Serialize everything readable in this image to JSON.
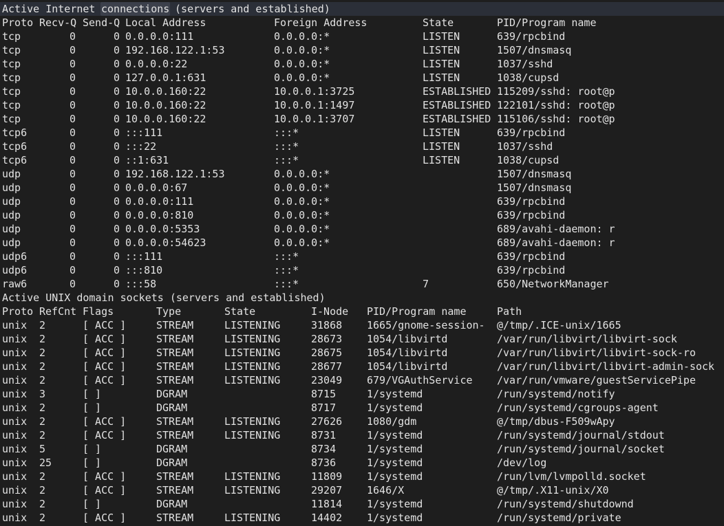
{
  "inet": {
    "title_prefix": "Active Internet ",
    "title_highlight": "connections",
    "title_suffix": " (servers and established)",
    "headers": [
      "Proto",
      "Recv-Q",
      "Send-Q",
      "Local Address",
      "Foreign Address",
      "State",
      "PID/Program name"
    ],
    "rows": [
      [
        "tcp",
        "0",
        "0",
        "0.0.0.0:111",
        "0.0.0.0:*",
        "LISTEN",
        "639/rpcbind"
      ],
      [
        "tcp",
        "0",
        "0",
        "192.168.122.1:53",
        "0.0.0.0:*",
        "LISTEN",
        "1507/dnsmasq"
      ],
      [
        "tcp",
        "0",
        "0",
        "0.0.0.0:22",
        "0.0.0.0:*",
        "LISTEN",
        "1037/sshd"
      ],
      [
        "tcp",
        "0",
        "0",
        "127.0.0.1:631",
        "0.0.0.0:*",
        "LISTEN",
        "1038/cupsd"
      ],
      [
        "tcp",
        "0",
        "0",
        "10.0.0.160:22",
        "10.0.0.1:3725",
        "ESTABLISHED",
        "115209/sshd: root@p"
      ],
      [
        "tcp",
        "0",
        "0",
        "10.0.0.160:22",
        "10.0.0.1:1497",
        "ESTABLISHED",
        "122101/sshd: root@p"
      ],
      [
        "tcp",
        "0",
        "0",
        "10.0.0.160:22",
        "10.0.0.1:3707",
        "ESTABLISHED",
        "115106/sshd: root@p"
      ],
      [
        "tcp6",
        "0",
        "0",
        ":::111",
        ":::*",
        "LISTEN",
        "639/rpcbind"
      ],
      [
        "tcp6",
        "0",
        "0",
        ":::22",
        ":::*",
        "LISTEN",
        "1037/sshd"
      ],
      [
        "tcp6",
        "0",
        "0",
        "::1:631",
        ":::*",
        "LISTEN",
        "1038/cupsd"
      ],
      [
        "udp",
        "0",
        "0",
        "192.168.122.1:53",
        "0.0.0.0:*",
        "",
        "1507/dnsmasq"
      ],
      [
        "udp",
        "0",
        "0",
        "0.0.0.0:67",
        "0.0.0.0:*",
        "",
        "1507/dnsmasq"
      ],
      [
        "udp",
        "0",
        "0",
        "0.0.0.0:111",
        "0.0.0.0:*",
        "",
        "639/rpcbind"
      ],
      [
        "udp",
        "0",
        "0",
        "0.0.0.0:810",
        "0.0.0.0:*",
        "",
        "639/rpcbind"
      ],
      [
        "udp",
        "0",
        "0",
        "0.0.0.0:5353",
        "0.0.0.0:*",
        "",
        "689/avahi-daemon: r"
      ],
      [
        "udp",
        "0",
        "0",
        "0.0.0.0:54623",
        "0.0.0.0:*",
        "",
        "689/avahi-daemon: r"
      ],
      [
        "udp6",
        "0",
        "0",
        ":::111",
        ":::*",
        "",
        "639/rpcbind"
      ],
      [
        "udp6",
        "0",
        "0",
        ":::810",
        ":::*",
        "",
        "639/rpcbind"
      ],
      [
        "raw6",
        "0",
        "0",
        ":::58",
        ":::*",
        "7",
        "650/NetworkManager"
      ]
    ]
  },
  "unix": {
    "title": "Active UNIX domain sockets (servers and established)",
    "headers": [
      "Proto",
      "RefCnt",
      "Flags",
      "Type",
      "State",
      "I-Node",
      "PID/Program name",
      "Path"
    ],
    "rows": [
      [
        "unix",
        "2",
        "[ ACC ]",
        "STREAM",
        "LISTENING",
        "31868",
        "1665/gnome-session-",
        "@/tmp/.ICE-unix/1665"
      ],
      [
        "unix",
        "2",
        "[ ACC ]",
        "STREAM",
        "LISTENING",
        "28673",
        "1054/libvirtd",
        "/var/run/libvirt/libvirt-sock"
      ],
      [
        "unix",
        "2",
        "[ ACC ]",
        "STREAM",
        "LISTENING",
        "28675",
        "1054/libvirtd",
        "/var/run/libvirt/libvirt-sock-ro"
      ],
      [
        "unix",
        "2",
        "[ ACC ]",
        "STREAM",
        "LISTENING",
        "28677",
        "1054/libvirtd",
        "/var/run/libvirt/libvirt-admin-sock"
      ],
      [
        "unix",
        "2",
        "[ ACC ]",
        "STREAM",
        "LISTENING",
        "23049",
        "679/VGAuthService",
        "/var/run/vmware/guestServicePipe"
      ],
      [
        "unix",
        "3",
        "[ ]",
        "DGRAM",
        "",
        "8715",
        "1/systemd",
        "/run/systemd/notify"
      ],
      [
        "unix",
        "2",
        "[ ]",
        "DGRAM",
        "",
        "8717",
        "1/systemd",
        "/run/systemd/cgroups-agent"
      ],
      [
        "unix",
        "2",
        "[ ACC ]",
        "STREAM",
        "LISTENING",
        "27626",
        "1080/gdm",
        "@/tmp/dbus-F509wApy"
      ],
      [
        "unix",
        "2",
        "[ ACC ]",
        "STREAM",
        "LISTENING",
        "8731",
        "1/systemd",
        "/run/systemd/journal/stdout"
      ],
      [
        "unix",
        "5",
        "[ ]",
        "DGRAM",
        "",
        "8734",
        "1/systemd",
        "/run/systemd/journal/socket"
      ],
      [
        "unix",
        "25",
        "[ ]",
        "DGRAM",
        "",
        "8736",
        "1/systemd",
        "/dev/log"
      ],
      [
        "unix",
        "2",
        "[ ACC ]",
        "STREAM",
        "LISTENING",
        "11809",
        "1/systemd",
        "/run/lvm/lvmpolld.socket"
      ],
      [
        "unix",
        "2",
        "[ ACC ]",
        "STREAM",
        "LISTENING",
        "29207",
        "1646/X",
        "@/tmp/.X11-unix/X0"
      ],
      [
        "unix",
        "2",
        "[ ]",
        "DGRAM",
        "",
        "11814",
        "1/systemd",
        "/run/systemd/shutdownd"
      ],
      [
        "unix",
        "2",
        "[ ACC ]",
        "STREAM",
        "LISTENING",
        "14402",
        "1/systemd",
        "/run/systemd/private"
      ]
    ]
  }
}
